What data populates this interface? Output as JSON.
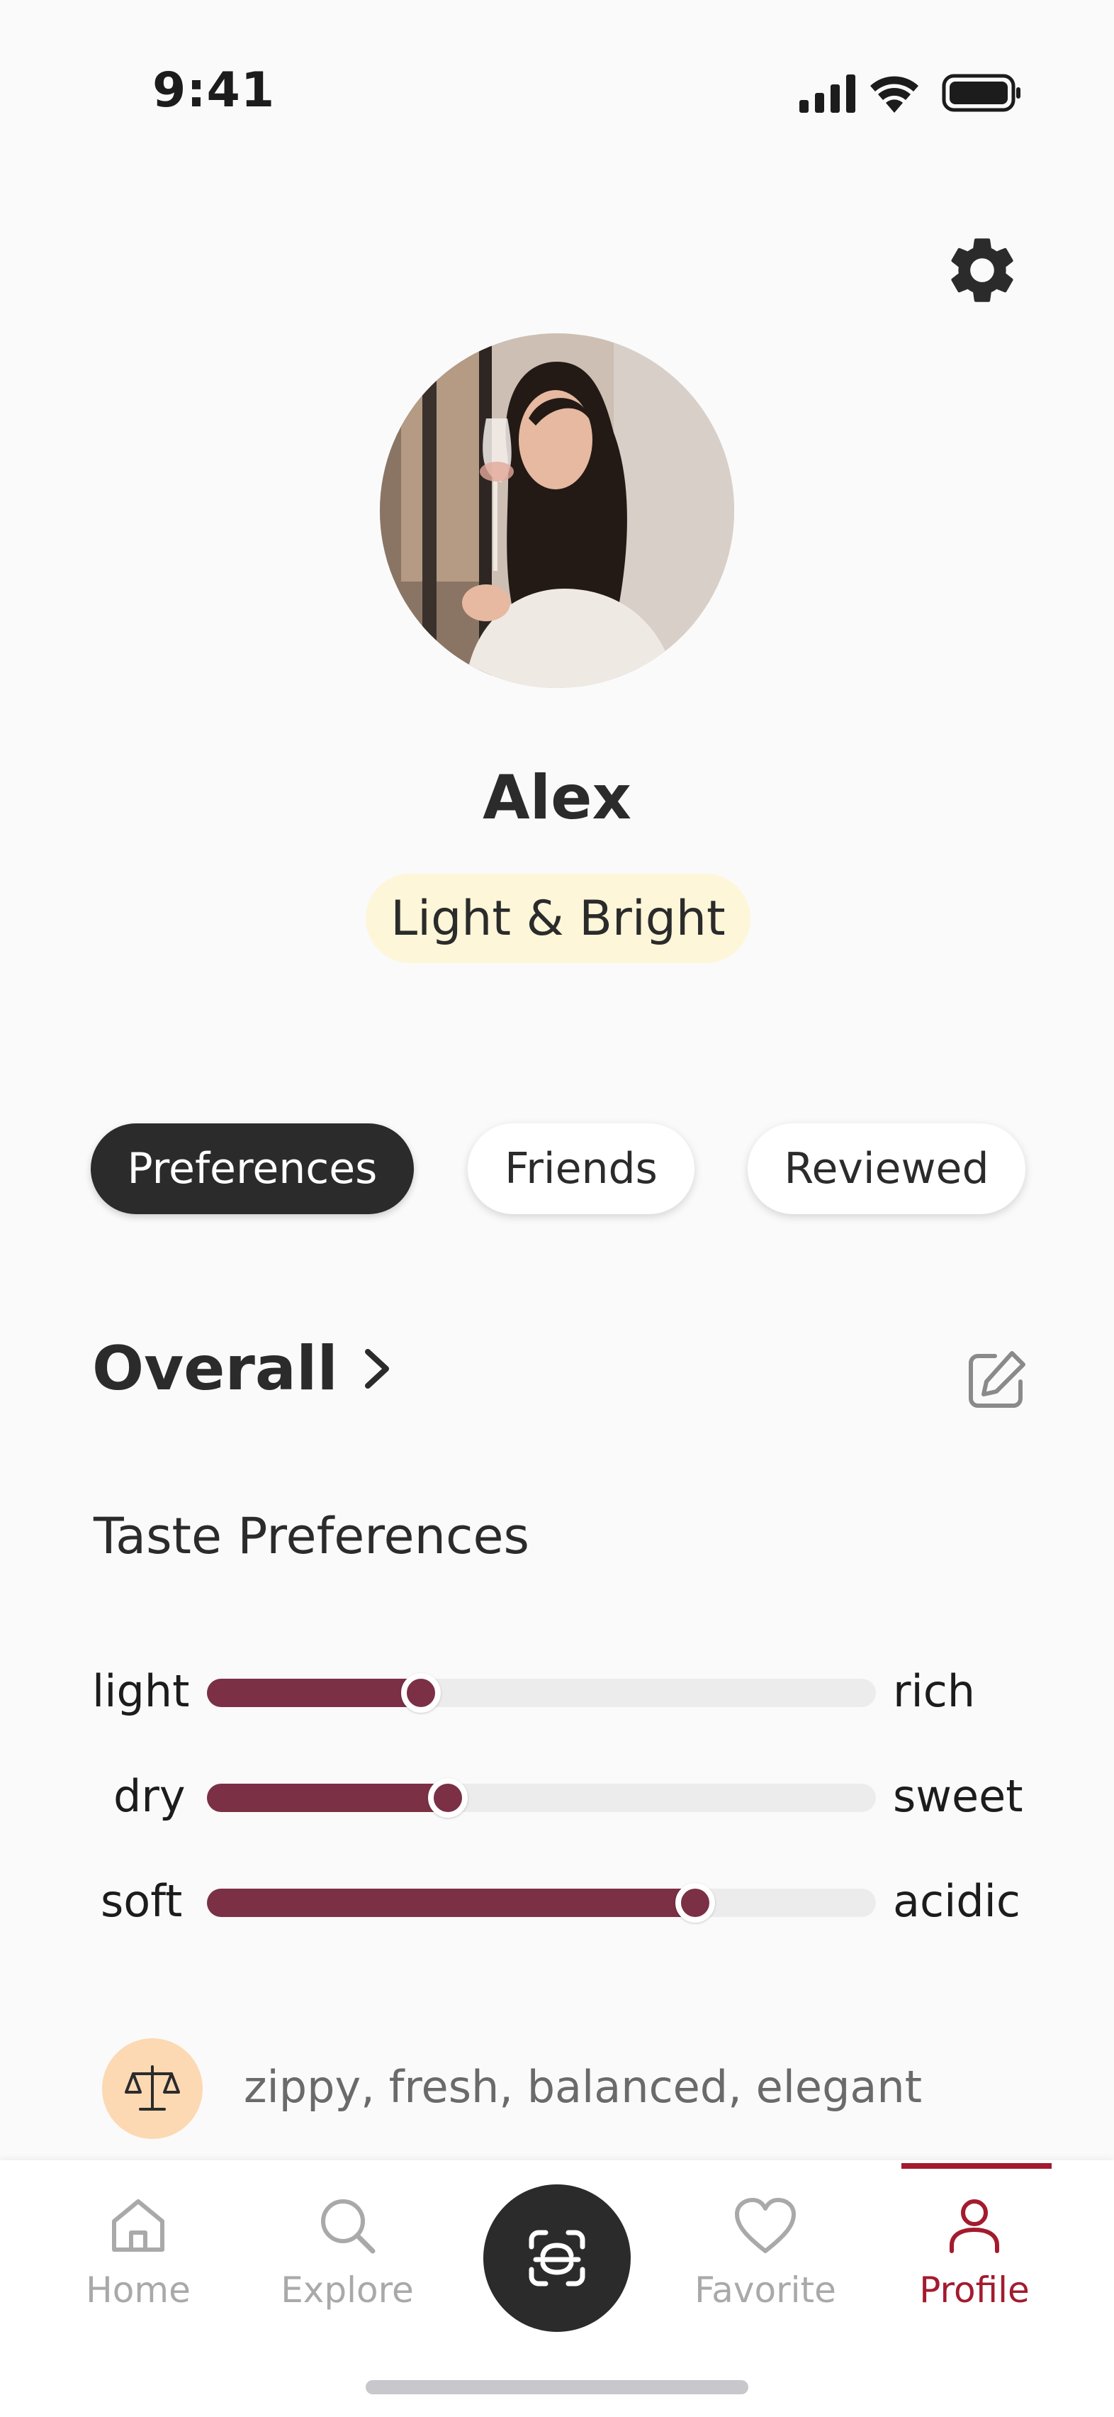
{
  "status_bar": {
    "time": "9:41"
  },
  "profile": {
    "name": "Alex",
    "badge": "Light & Bright"
  },
  "tabs": [
    {
      "label": "Preferences",
      "active": true
    },
    {
      "label": "Friends",
      "active": false
    },
    {
      "label": "Reviewed",
      "active": false
    }
  ],
  "overall": {
    "title": "Overall"
  },
  "taste": {
    "title": "Taste Preferences",
    "sliders": [
      {
        "left": "light",
        "right": "rich",
        "value": 0.32
      },
      {
        "left": "dry",
        "right": "sweet",
        "value": 0.36
      },
      {
        "left": "soft",
        "right": "acidic",
        "value": 0.73
      }
    ],
    "descriptors": "zippy, fresh, balanced, elegant"
  },
  "bottom_nav": {
    "items": [
      {
        "label": "Home",
        "icon": "home-icon",
        "active": false
      },
      {
        "label": "Explore",
        "icon": "search-icon",
        "active": false
      },
      {
        "label": "Favorite",
        "icon": "heart-icon",
        "active": false
      },
      {
        "label": "Profile",
        "icon": "person-icon",
        "active": true
      }
    ],
    "scan_icon": "scan-icon"
  },
  "colors": {
    "accent": "#7b3045",
    "nav_active": "#a31b2e",
    "badge_bg": "#fdf6d9",
    "dark": "#2b2b2b",
    "track": "#ececec",
    "descriptor_icon_bg": "#fcd9b3"
  }
}
